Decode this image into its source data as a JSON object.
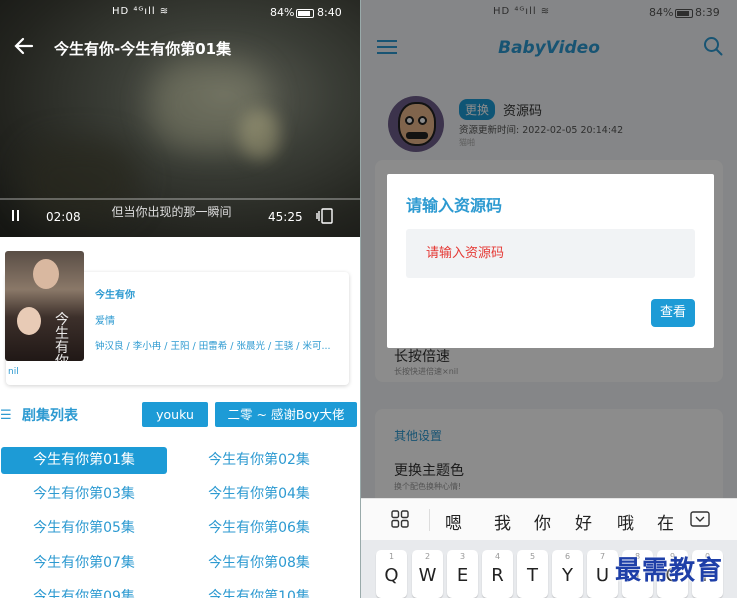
{
  "left": {
    "status": {
      "signal": "HD ⁴ᴳıll ≋",
      "battery": "84%",
      "time": "8:40"
    },
    "player": {
      "title": "今生有你-今生有你第01集",
      "subtitle": "但当你出现的那一瞬间",
      "current_time": "02:08",
      "duration": "45:25"
    },
    "info": {
      "poster_title": "今生有你",
      "title": "今生有你",
      "genre": "爱情",
      "cast": "钟汉良 / 李小冉 / 王阳 / 田雷希 / 张晨光 / 王骁 / 米可...",
      "nil": "nil"
    },
    "episodes_header": "剧集列表",
    "source_buttons": [
      "youku",
      "二零 ~ 感谢Boy大佬"
    ],
    "episodes": [
      "今生有你第01集",
      "今生有你第02集",
      "今生有你第03集",
      "今生有你第04集",
      "今生有你第05集",
      "今生有你第06集",
      "今生有你第07集",
      "今生有你第08集",
      "今生有你第09集",
      "今生有你第10集"
    ],
    "active_episode": "今生有你第01集"
  },
  "right": {
    "status": {
      "signal": "HD ⁴ᴳıll ≋",
      "battery": "84%",
      "time": "8:39"
    },
    "brand": "BabyVideo",
    "profile": {
      "swap_label": "更换",
      "source_label": "资源码",
      "update_time": "资源更新时间: 2022-02-05 20:14:42",
      "sub": "猫啪"
    },
    "settings": {
      "long_press_title": "长按倍速",
      "long_press_sub": "长按快进倍速×nil",
      "other_header": "其他设置",
      "theme_title": "更换主题色",
      "theme_sub": "换个配色换种心情!"
    },
    "dialog": {
      "title": "请输入资源码",
      "placeholder": "请输入资源码",
      "button": "查看"
    },
    "candidates": [
      "嗯",
      "我",
      "你",
      "好",
      "哦",
      "在"
    ],
    "keys": [
      {
        "n": "1",
        "l": "Q"
      },
      {
        "n": "2",
        "l": "W"
      },
      {
        "n": "3",
        "l": "E"
      },
      {
        "n": "4",
        "l": "R"
      },
      {
        "n": "5",
        "l": "T"
      },
      {
        "n": "6",
        "l": "Y"
      },
      {
        "n": "7",
        "l": "U"
      },
      {
        "n": "8",
        "l": "I"
      },
      {
        "n": "9",
        "l": "O"
      },
      {
        "n": "0",
        "l": "P"
      }
    ]
  },
  "watermark": "最需教育",
  "colors": {
    "accent": "#1d9bd6",
    "text_blue": "#2d9ad1",
    "placeholder_red": "#e53935",
    "watermark": "#1e3fa8"
  }
}
